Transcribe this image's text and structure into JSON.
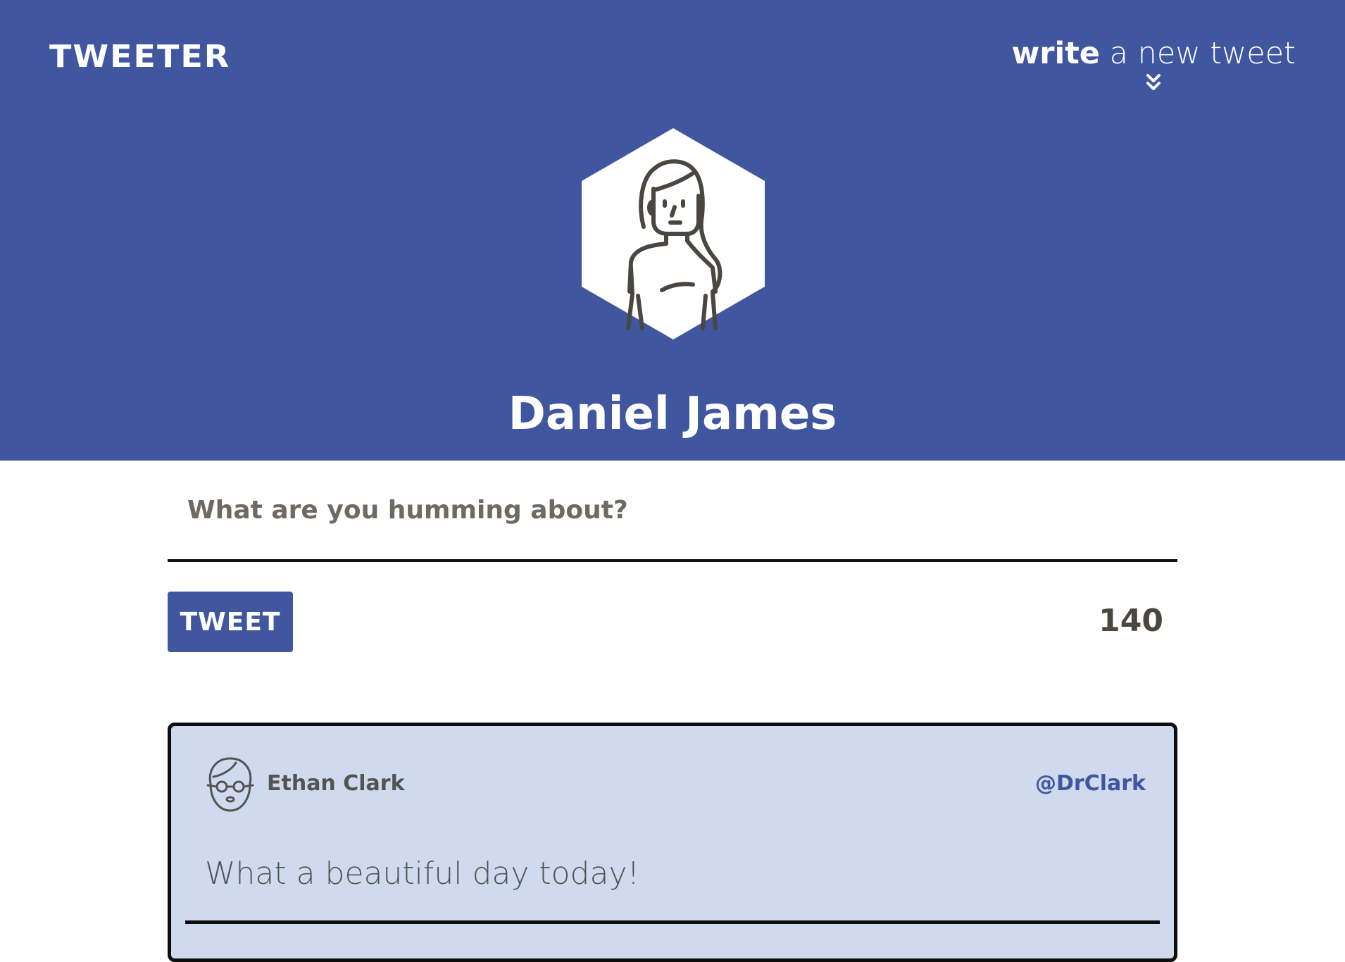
{
  "app": {
    "brand": "TWEETER"
  },
  "header": {
    "compose_toggle_bold": "write",
    "compose_toggle_light": " a new tweet",
    "compose_toggle_icon": "double-chevron-down-icon",
    "profile_avatar_icon": "woman-avatar-icon",
    "profile_name": "Daniel James"
  },
  "compose": {
    "placeholder": "What are you humming about?",
    "value": "",
    "submit_label": "TWEET",
    "char_counter": "140"
  },
  "tweets": [
    {
      "author": "Ethan Clark",
      "handle": "@DrClark",
      "avatar_icon": "man-with-glasses-avatar-icon",
      "text": "What a beautiful day today!"
    }
  ],
  "colors": {
    "brand_blue": "#4057a0",
    "tweet_bg": "#cfdaee",
    "text_gray": "#555350",
    "white": "#ffffff"
  }
}
